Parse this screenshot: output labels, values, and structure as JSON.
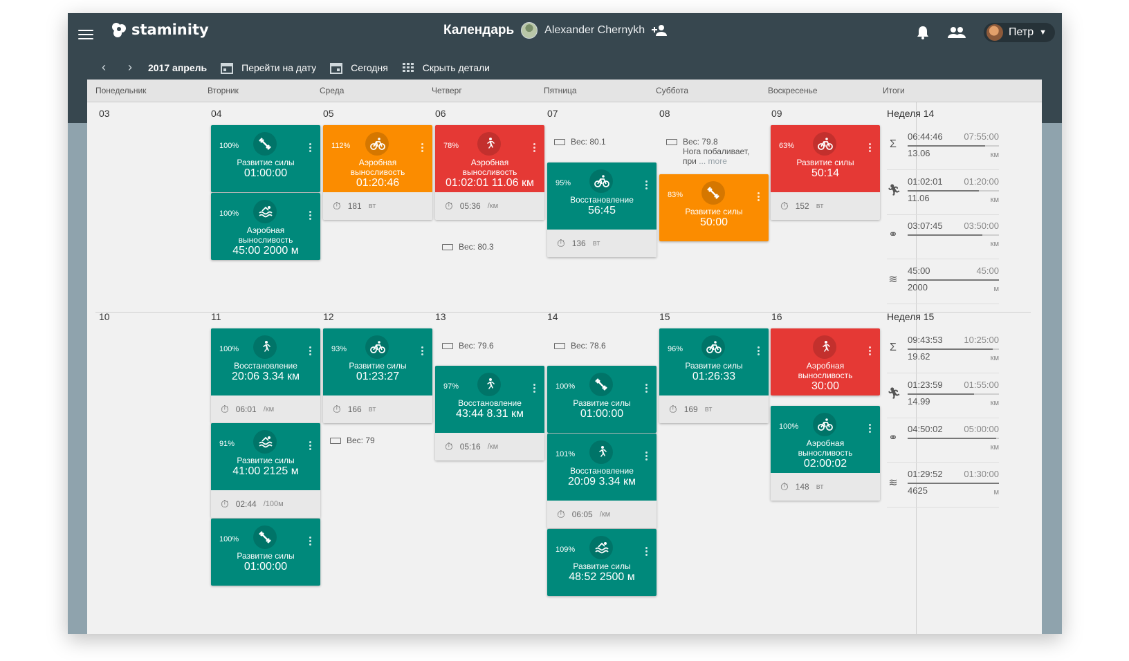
{
  "app": {
    "logo": "staminity"
  },
  "header": {
    "title": "Календарь",
    "athlete": "Alexander Chernykh",
    "user": "Петр"
  },
  "toolbar": {
    "period": "2017 апрель",
    "goto": "Перейти на дату",
    "today": "Сегодня",
    "hide": "Скрыть детали"
  },
  "days": [
    "Понедельник",
    "Вторник",
    "Среда",
    "Четверг",
    "Пятница",
    "Суббота",
    "Воскресенье",
    "Итоги"
  ],
  "weeks": [
    {
      "name": "Неделя 14",
      "dates": [
        "03",
        "04",
        "05",
        "06",
        "07",
        "08",
        "09"
      ]
    },
    {
      "name": "Неделя 15",
      "dates": [
        "10",
        "11",
        "12",
        "13",
        "14",
        "15",
        "16"
      ]
    }
  ],
  "cards": [
    {
      "color": "green",
      "pct": "100%",
      "icon": "strength-icon",
      "label": "Развитие силы",
      "value": "01:00:00",
      "foot": null
    },
    {
      "color": "green",
      "pct": "100%",
      "icon": "swim-icon",
      "label": "Аэробная выносливость",
      "value": "45:00  2000 м",
      "foot": null
    },
    {
      "color": "orange",
      "pct": "112%",
      "icon": "bike-icon",
      "label": "Аэробная выносливость",
      "value": "01:20:46",
      "foot": "181",
      "unit": "вт"
    },
    {
      "color": "red",
      "pct": "78%",
      "icon": "run-icon",
      "label": "Аэробная выносливость",
      "value": "01:02:01  11.06 км",
      "foot": "05:36",
      "unit": "/км"
    },
    {
      "color": "green",
      "pct": "95%",
      "icon": "bike-icon",
      "label": "Восстановление",
      "value": "56:45",
      "foot": "136",
      "unit": "вт"
    },
    {
      "color": "orange",
      "pct": "83%",
      "icon": "strength-icon",
      "label": "Развитие силы",
      "value": "50:00",
      "foot": null
    },
    {
      "color": "red",
      "pct": "63%",
      "icon": "bike-icon",
      "label": "Развитие силы",
      "value": "50:14",
      "foot": "152",
      "unit": "вт"
    },
    {
      "color": "green",
      "pct": "100%",
      "icon": "run-icon",
      "label": "Восстановление",
      "value": "20:06  3.34 км",
      "foot": "06:01",
      "unit": "/км"
    },
    {
      "color": "green",
      "pct": "91%",
      "icon": "swim-icon",
      "label": "Развитие силы",
      "value": "41:00  2125 м",
      "foot": "02:44",
      "unit": "/100м"
    },
    {
      "color": "green",
      "pct": "100%",
      "icon": "strength-icon",
      "label": "Развитие силы",
      "value": "01:00:00",
      "foot": null
    },
    {
      "color": "green",
      "pct": "93%",
      "icon": "bike-icon",
      "label": "Развитие силы",
      "value": "01:23:27",
      "foot": "166",
      "unit": "вт"
    },
    {
      "color": "green",
      "pct": "97%",
      "icon": "run-icon",
      "label": "Восстановление",
      "value": "43:44  8.31 км",
      "foot": "05:16",
      "unit": "/км"
    },
    {
      "color": "green",
      "pct": "100%",
      "icon": "strength-icon",
      "label": "Развитие силы",
      "value": "01:00:00",
      "foot": null
    },
    {
      "color": "green",
      "pct": "101%",
      "icon": "run-icon",
      "label": "Восстановление",
      "value": "20:09  3.34 км",
      "foot": "06:05",
      "unit": "/км"
    },
    {
      "color": "green",
      "pct": "109%",
      "icon": "swim-icon",
      "label": "Развитие силы",
      "value": "48:52  2500 м",
      "foot": null
    },
    {
      "color": "green",
      "pct": "96%",
      "icon": "bike-icon",
      "label": "Развитие силы",
      "value": "01:26:33",
      "foot": "169",
      "unit": "вт"
    },
    {
      "color": "red",
      "pct": "",
      "icon": "run-icon",
      "label": "Аэробная выносливость",
      "value": "30:00",
      "foot": null
    },
    {
      "color": "green",
      "pct": "100%",
      "icon": "bike-icon",
      "label": "Аэробная выносливость",
      "value": "02:00:02",
      "foot": "148",
      "unit": "вт"
    }
  ],
  "notes": [
    {
      "text": "Вес: 80.1"
    },
    {
      "text": "Вес: 79.8",
      "extra": "Нога побаливает,",
      "extra2": "при",
      "more": "... more"
    },
    {
      "text": "Вес: 80.3"
    },
    {
      "text": "Вес: 79.6"
    },
    {
      "text": "Вес: 78.6"
    },
    {
      "text": "Вес: 79"
    }
  ],
  "totals": [
    {
      "icon": "sigma-icon",
      "a": "06:44:46",
      "p": "07:55:00",
      "d": "13.06",
      "u": "км",
      "fill": 0.85
    },
    {
      "icon": "run-icon",
      "a": "01:02:01",
      "p": "01:20:00",
      "d": "11.06",
      "u": "км",
      "fill": 0.78
    },
    {
      "icon": "bike-icon",
      "a": "03:07:45",
      "p": "03:50:00",
      "d": "",
      "u": "км",
      "fill": 0.82
    },
    {
      "icon": "swim-icon",
      "a": "45:00",
      "p": "45:00",
      "d": "2000",
      "u": "м",
      "fill": 1.0
    },
    {
      "icon": "sigma-icon",
      "a": "09:43:53",
      "p": "10:25:00",
      "d": "19.62",
      "u": "км",
      "fill": 0.93
    },
    {
      "icon": "run-icon",
      "a": "01:23:59",
      "p": "01:55:00",
      "d": "14.99",
      "u": "км",
      "fill": 0.73
    },
    {
      "icon": "bike-icon",
      "a": "04:50:02",
      "p": "05:00:00",
      "d": "",
      "u": "км",
      "fill": 0.97
    },
    {
      "icon": "swim-icon",
      "a": "01:29:52",
      "p": "01:30:00",
      "d": "4625",
      "u": "м",
      "fill": 1.0
    }
  ]
}
